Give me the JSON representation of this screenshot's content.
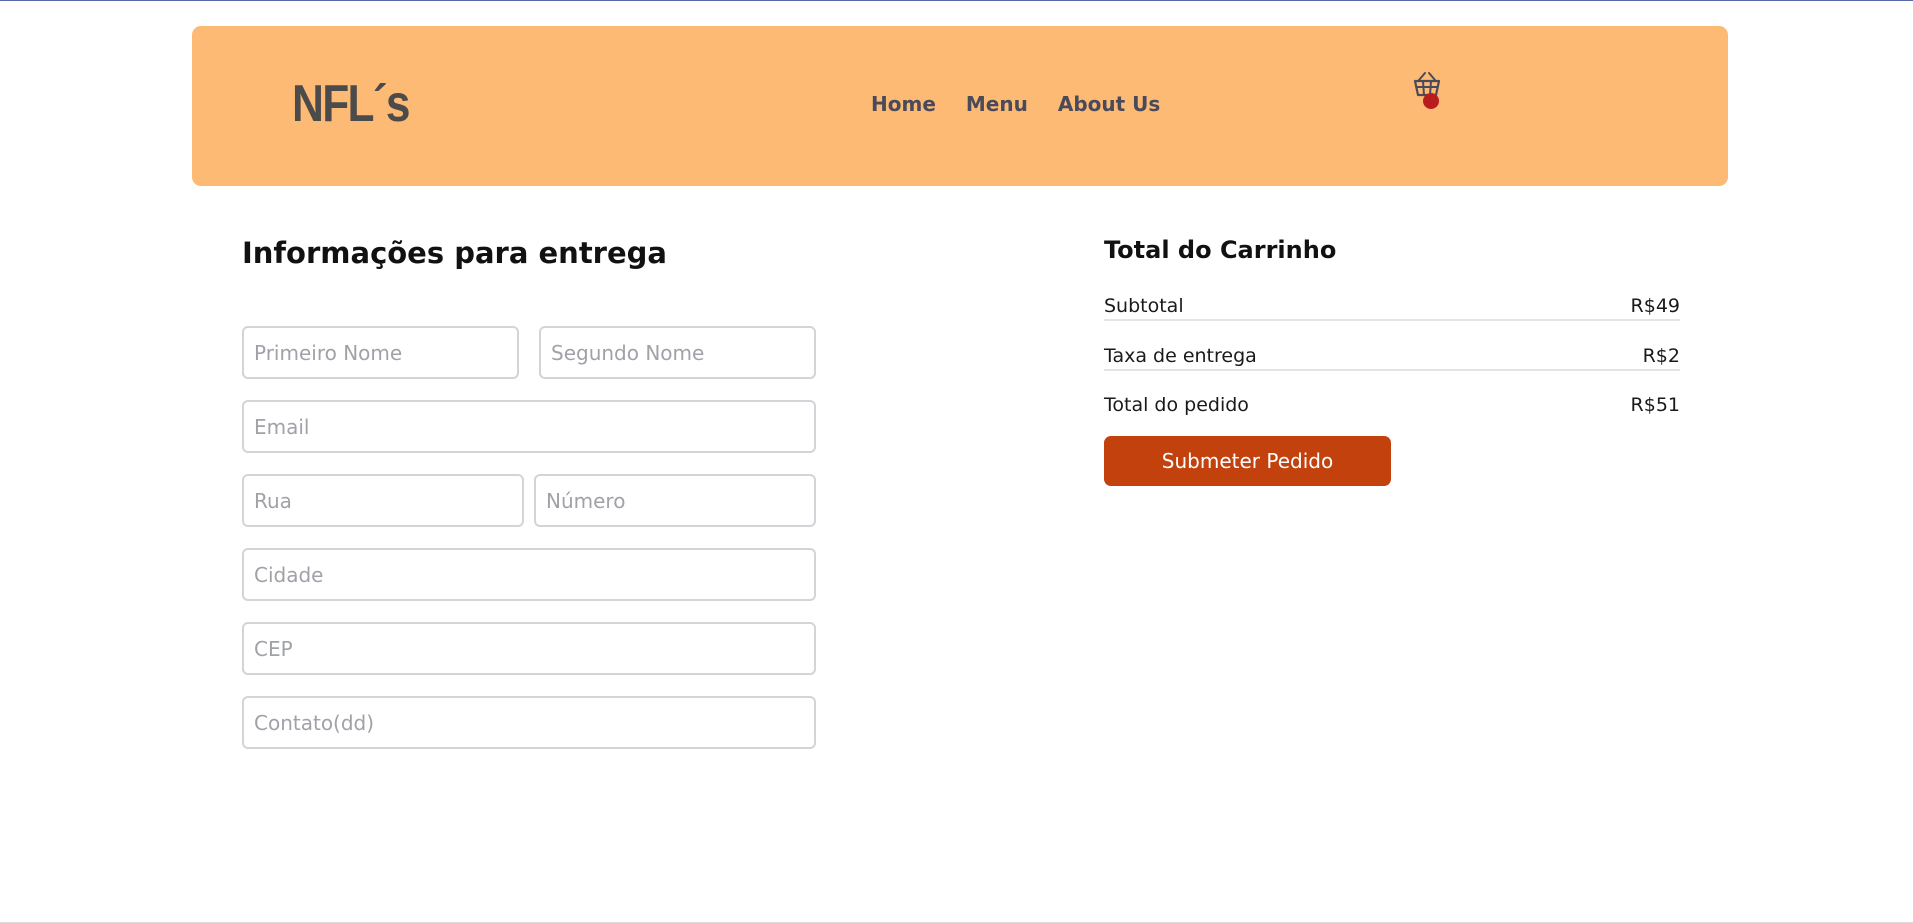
{
  "header": {
    "logo": "NFL´s",
    "nav": [
      {
        "label": "Home"
      },
      {
        "label": "Menu"
      },
      {
        "label": "About Us"
      }
    ],
    "cart_icon": "basket-icon",
    "colors": {
      "background": "#fdba74",
      "badge": "#b91c1c"
    }
  },
  "delivery": {
    "title": "Informações para entrega",
    "fields": {
      "first_name": {
        "placeholder": "Primeiro Nome",
        "value": ""
      },
      "last_name": {
        "placeholder": "Segundo Nome",
        "value": ""
      },
      "email": {
        "placeholder": "Email",
        "value": ""
      },
      "street": {
        "placeholder": "Rua",
        "value": ""
      },
      "number": {
        "placeholder": "Número",
        "value": ""
      },
      "city": {
        "placeholder": "Cidade",
        "value": ""
      },
      "zip": {
        "placeholder": "CEP",
        "value": ""
      },
      "contact": {
        "placeholder": "Contato(dd)",
        "value": ""
      }
    }
  },
  "cart_total": {
    "title": "Total do Carrinho",
    "rows": [
      {
        "label": "Subtotal",
        "value": "R$49"
      },
      {
        "label": "Taxa de entrega",
        "value": "R$2"
      },
      {
        "label": "Total do pedido",
        "value": "R$51"
      }
    ],
    "submit_label": "Submeter Pedido",
    "colors": {
      "button": "#c2410c"
    }
  }
}
